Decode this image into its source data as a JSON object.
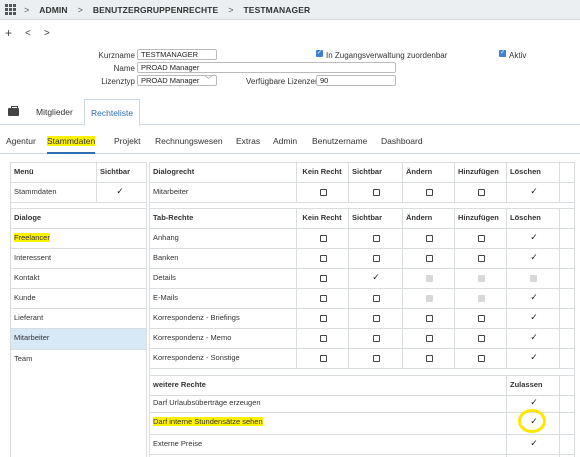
{
  "breadcrumb": {
    "items": [
      "ADMIN",
      "BENUTZERGRUPPENRECHTE",
      "TESTMANAGER"
    ],
    "separator": ">"
  },
  "toolbar": {
    "add": "+",
    "back": "<",
    "forward": ">"
  },
  "form": {
    "kurzname_label": "Kurzname",
    "kurzname_value": "TESTMANAGER",
    "name_label": "Name",
    "name_value": "PROAD Manager",
    "lizenztyp_label": "Lizenztyp",
    "lizenztyp_value": "PROAD Manager",
    "verfuegbare_label": "Verfügbare Lizenzen",
    "verfuegbare_value": "90",
    "zugangsverwaltung_label": "In Zugangsverwaltung zuordenbar",
    "aktiv_label": "Aktiv",
    "checkmark": "✓",
    "dropdown_chevron": "﹀"
  },
  "main_tabs": [
    "Mitglieder",
    "Rechteliste"
  ],
  "sub_tabs": [
    "Agentur",
    "Stammdaten",
    "Projekt",
    "Rechnungswesen",
    "Extras",
    "Admin",
    "Benutzername",
    "Dashboard"
  ],
  "left_table": {
    "menu_header": "Menü",
    "sichtbar_header": "Sichtbar",
    "menu_row": "Stammdaten",
    "dialoge_header": "Dialoge",
    "dialoge": [
      "Freelancer",
      "Interessent",
      "Kontakt",
      "Kunde",
      "Lieferant",
      "Mitarbeiter",
      "Team"
    ]
  },
  "right_table": {
    "dialogrecht_headers": [
      "Dialogrecht",
      "Kein Recht",
      "Sichtbar",
      "Ändern",
      "Hinzufügen",
      "Löschen"
    ],
    "dialogrecht_row": "Mitarbeiter",
    "tabrechte_headers": [
      "Tab-Rechte",
      "Kein Recht",
      "Sichtbar",
      "Ändern",
      "Hinzufügen",
      "Löschen"
    ],
    "tab_rows": [
      "Anhang",
      "Banken",
      "Details",
      "E-Mails",
      "Korrespondenz - Briefings",
      "Korrespondenz - Memo",
      "Korrespondenz - Sonstige"
    ],
    "weitere_header": "weitere Rechte",
    "zulassen_header": "Zulassen",
    "weitere_rows": [
      "Darf Urlaubsüberträge erzeugen",
      "Darf interne Stundensätze sehen",
      "Externe Preise"
    ]
  },
  "colors": {
    "highlight": "#fff200",
    "accent": "#2d6db5",
    "selected_row": "#d7e8f7",
    "circle": "#ffe600"
  }
}
